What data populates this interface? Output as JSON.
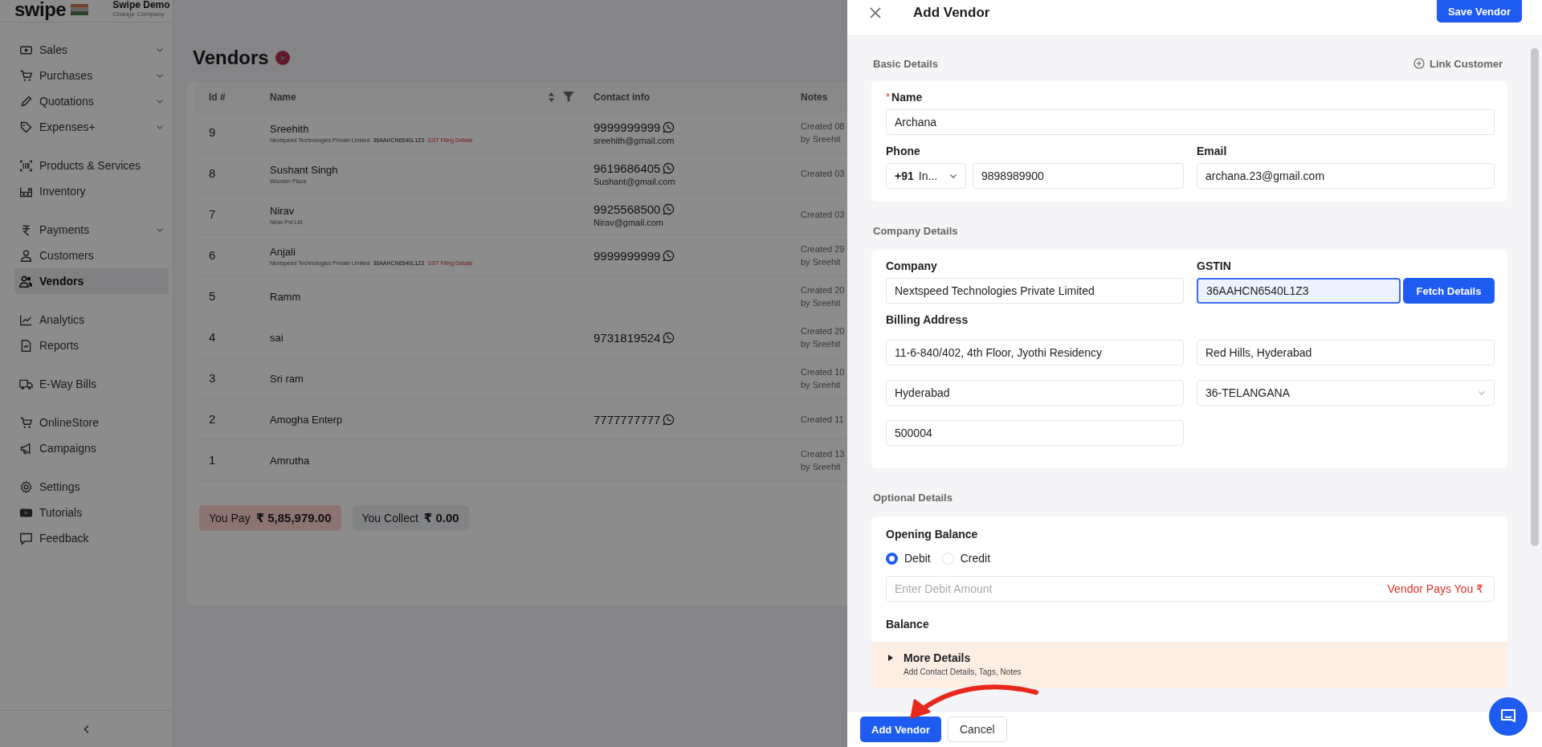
{
  "sidebar": {
    "logo": "swipe",
    "company": "Swipe Demo",
    "change_company": "Change Company",
    "groups": [
      [
        {
          "label": "Sales",
          "expandable": true,
          "selected": false
        },
        {
          "label": "Purchases",
          "expandable": true,
          "selected": false
        },
        {
          "label": "Quotations",
          "expandable": true,
          "selected": false
        },
        {
          "label": "Expenses+",
          "expandable": true,
          "selected": false
        }
      ],
      [
        {
          "label": "Products & Services",
          "expandable": false,
          "selected": false
        },
        {
          "label": "Inventory",
          "expandable": false,
          "selected": false
        }
      ],
      [
        {
          "label": "Payments",
          "expandable": true,
          "selected": false
        },
        {
          "label": "Customers",
          "expandable": false,
          "selected": false
        },
        {
          "label": "Vendors",
          "expandable": false,
          "selected": true
        }
      ],
      [
        {
          "label": "Analytics",
          "expandable": false,
          "selected": false
        },
        {
          "label": "Reports",
          "expandable": false,
          "selected": false
        }
      ],
      [
        {
          "label": "E-Way Bills",
          "expandable": false,
          "selected": false
        }
      ],
      [
        {
          "label": "OnlineStore",
          "expandable": false,
          "selected": false
        },
        {
          "label": "Campaigns",
          "expandable": false,
          "selected": false
        }
      ],
      [
        {
          "label": "Settings",
          "expandable": false,
          "selected": false
        },
        {
          "label": "Tutorials",
          "expandable": false,
          "selected": false
        },
        {
          "label": "Feedback",
          "expandable": false,
          "selected": false
        }
      ]
    ]
  },
  "page": {
    "title": "Vendors",
    "table": {
      "columns": [
        "Id #",
        "Name",
        "Contact info",
        "Notes"
      ],
      "rows": [
        {
          "id": "9",
          "name": "Sreehith",
          "company": "Nextspeed Technologies Private Limited",
          "gstin": "36AAHCN6540L1Z3",
          "gst_link": "GST Filing Details",
          "phone": "9999999999",
          "email": "sreehith@gmail.com",
          "notes": [
            "Created 08",
            "by Sreehit"
          ]
        },
        {
          "id": "8",
          "name": "Sushant Singh",
          "company": "Wooden Plaza",
          "phone": "9619686405",
          "email": "Sushant@gmail.com",
          "notes": [
            "Created 03"
          ]
        },
        {
          "id": "7",
          "name": "Nirav",
          "company": "Nirav Pvt Ltd",
          "phone": "9925568500",
          "email": "Nirav@gmail.com",
          "notes": [
            "Created 03"
          ]
        },
        {
          "id": "6",
          "name": "Anjali",
          "company": "Nextspeed Technologies Private Limited",
          "gstin": "36AAHCN6540L1Z3",
          "gst_link": "GST Filing Details",
          "phone": "9999999999",
          "notes": [
            "Created 29",
            "by Sreehit"
          ]
        },
        {
          "id": "5",
          "name": "Ramm",
          "notes": [
            "Created 20",
            "by Sreehit"
          ]
        },
        {
          "id": "4",
          "name": "sai",
          "phone": "9731819524",
          "notes": [
            "Created 20",
            "by Sreehit"
          ]
        },
        {
          "id": "3",
          "name": "Sri ram",
          "notes": [
            "Created 10",
            "by Sreehit"
          ]
        },
        {
          "id": "2",
          "name": "Amogha Enterp",
          "phone": "7777777777",
          "notes": [
            "Created 11"
          ]
        },
        {
          "id": "1",
          "name": "Amrutha",
          "notes": [
            "Created 13",
            "by Sreehit"
          ]
        }
      ]
    },
    "summary": [
      {
        "kind": "pay",
        "label": "You Pay",
        "amount": "₹ 5,85,979.00"
      },
      {
        "kind": "collect",
        "label": "You Collect",
        "amount": "₹ 0.00"
      }
    ]
  },
  "drawer": {
    "title": "Add Vendor",
    "save": "Save Vendor",
    "basic": {
      "heading": "Basic Details",
      "link": "Link Customer",
      "name": {
        "label": "Name",
        "required_mark": "*",
        "value": "Archana"
      },
      "phone": {
        "label": "Phone",
        "code": "+91",
        "country": "In...",
        "value": "9898989900"
      },
      "email": {
        "label": "Email",
        "value": "archana.23@gmail.com"
      }
    },
    "company": {
      "heading": "Company Details",
      "company": {
        "label": "Company",
        "value": "Nextspeed Technologies Private Limited"
      },
      "gstin": {
        "label": "GSTIN",
        "value": "36AAHCN6540L1Z3",
        "focused": true
      },
      "fetch": "Fetch Details",
      "address_label": "Billing Address",
      "address_fields": [
        {
          "kind": "text",
          "value": "11-6-840/402, 4th Floor, Jyothi Residency"
        },
        {
          "kind": "text",
          "value": "Red Hills, Hyderabad"
        },
        {
          "kind": "text",
          "value": "Hyderabad"
        },
        {
          "kind": "select",
          "value": "36-TELANGANA"
        },
        {
          "kind": "text",
          "value": "500004"
        }
      ]
    },
    "optional": {
      "heading": "Optional Details",
      "opening_label": "Opening Balance",
      "options": [
        {
          "label": "Debit",
          "selected": true
        },
        {
          "label": "Credit",
          "selected": false
        }
      ],
      "amount": {
        "placeholder": "Enter Debit Amount",
        "hint": "Vendor Pays You ₹"
      },
      "balance_label": "Balance",
      "more": {
        "title": "More Details",
        "subtitle": "Add Contact Details, Tags, Notes",
        "expanded": false
      }
    },
    "footer": {
      "primary": "Add Vendor",
      "secondary": "Cancel"
    }
  }
}
